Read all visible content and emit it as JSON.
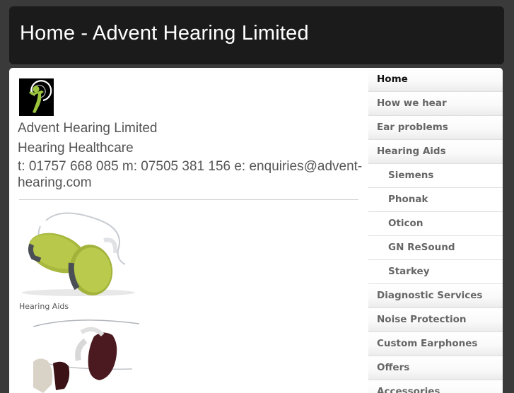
{
  "header": {
    "title": "Home - Advent Hearing Limited"
  },
  "content": {
    "company": "Advent Hearing Limited",
    "tagline": "Hearing Healthcare",
    "contact": "t: 01757 668 085 m: 07505 381 156 e: enquiries@advent-hearing.com",
    "image1_caption": "Hearing Aids"
  },
  "colors": {
    "brand_green": "#9bc53d",
    "header_bg": "#1b1b1b"
  },
  "sidebar": {
    "items": [
      {
        "label": "Home",
        "active": true
      },
      {
        "label": "How we hear"
      },
      {
        "label": "Ear problems"
      },
      {
        "label": "Hearing Aids"
      },
      {
        "label": "Siemens",
        "sub": true
      },
      {
        "label": "Phonak",
        "sub": true
      },
      {
        "label": "Oticon",
        "sub": true
      },
      {
        "label": "GN ReSound",
        "sub": true
      },
      {
        "label": "Starkey",
        "sub": true
      },
      {
        "label": "Diagnostic Services"
      },
      {
        "label": "Noise Protection"
      },
      {
        "label": "Custom Earphones"
      },
      {
        "label": "Offers"
      },
      {
        "label": "Accessories"
      }
    ]
  }
}
